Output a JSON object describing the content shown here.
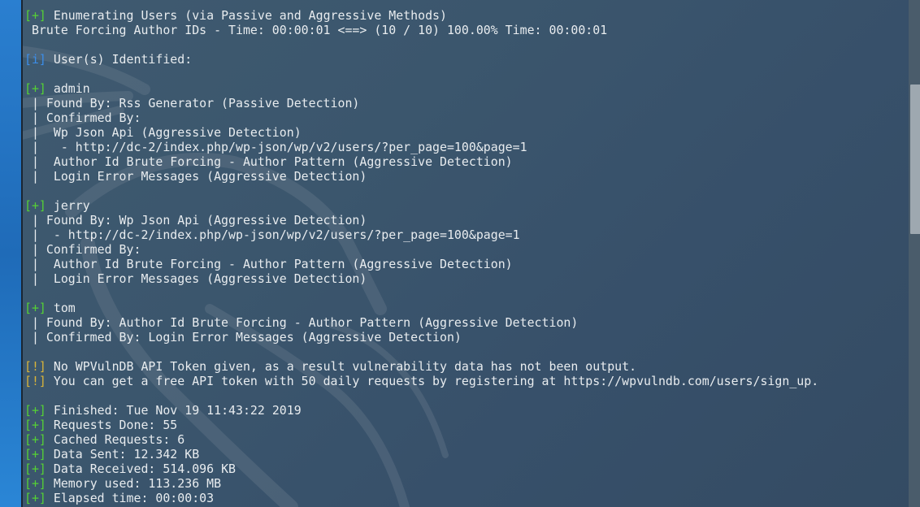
{
  "colors": {
    "plus_tag": "#55d135",
    "info_tag": "#3b8eea",
    "warn_tag": "#d9b43a",
    "text": "#e8ecef"
  },
  "lines": [
    {
      "tag": "[+]",
      "kind": "plus",
      "text": " Enumerating Users (via Passive and Aggressive Methods)"
    },
    {
      "tag": "",
      "kind": "",
      "text": " Brute Forcing Author IDs - Time: 00:00:01 <==> (10 / 10) 100.00% Time: 00:00:01"
    },
    {
      "tag": "",
      "kind": "",
      "text": ""
    },
    {
      "tag": "[i]",
      "kind": "info",
      "text": " User(s) Identified:"
    },
    {
      "tag": "",
      "kind": "",
      "text": ""
    },
    {
      "tag": "[+]",
      "kind": "plus",
      "text": " admin"
    },
    {
      "tag": "",
      "kind": "",
      "text": " | Found By: Rss Generator (Passive Detection)"
    },
    {
      "tag": "",
      "kind": "",
      "text": " | Confirmed By:"
    },
    {
      "tag": "",
      "kind": "",
      "text": " |  Wp Json Api (Aggressive Detection)"
    },
    {
      "tag": "",
      "kind": "",
      "text": " |   - http://dc-2/index.php/wp-json/wp/v2/users/?per_page=100&page=1"
    },
    {
      "tag": "",
      "kind": "",
      "text": " |  Author Id Brute Forcing - Author Pattern (Aggressive Detection)"
    },
    {
      "tag": "",
      "kind": "",
      "text": " |  Login Error Messages (Aggressive Detection)"
    },
    {
      "tag": "",
      "kind": "",
      "text": ""
    },
    {
      "tag": "[+]",
      "kind": "plus",
      "text": " jerry"
    },
    {
      "tag": "",
      "kind": "",
      "text": " | Found By: Wp Json Api (Aggressive Detection)"
    },
    {
      "tag": "",
      "kind": "",
      "text": " |  - http://dc-2/index.php/wp-json/wp/v2/users/?per_page=100&page=1"
    },
    {
      "tag": "",
      "kind": "",
      "text": " | Confirmed By:"
    },
    {
      "tag": "",
      "kind": "",
      "text": " |  Author Id Brute Forcing - Author Pattern (Aggressive Detection)"
    },
    {
      "tag": "",
      "kind": "",
      "text": " |  Login Error Messages (Aggressive Detection)"
    },
    {
      "tag": "",
      "kind": "",
      "text": ""
    },
    {
      "tag": "[+]",
      "kind": "plus",
      "text": " tom"
    },
    {
      "tag": "",
      "kind": "",
      "text": " | Found By: Author Id Brute Forcing - Author Pattern (Aggressive Detection)"
    },
    {
      "tag": "",
      "kind": "",
      "text": " | Confirmed By: Login Error Messages (Aggressive Detection)"
    },
    {
      "tag": "",
      "kind": "",
      "text": ""
    },
    {
      "tag": "[!]",
      "kind": "warn",
      "text": " No WPVulnDB API Token given, as a result vulnerability data has not been output."
    },
    {
      "tag": "[!]",
      "kind": "warn",
      "text": " You can get a free API token with 50 daily requests by registering at https://wpvulndb.com/users/sign_up."
    },
    {
      "tag": "",
      "kind": "",
      "text": ""
    },
    {
      "tag": "[+]",
      "kind": "plus",
      "text": " Finished: Tue Nov 19 11:43:22 2019"
    },
    {
      "tag": "[+]",
      "kind": "plus",
      "text": " Requests Done: 55"
    },
    {
      "tag": "[+]",
      "kind": "plus",
      "text": " Cached Requests: 6"
    },
    {
      "tag": "[+]",
      "kind": "plus",
      "text": " Data Sent: 12.342 KB"
    },
    {
      "tag": "[+]",
      "kind": "plus",
      "text": " Data Received: 514.096 KB"
    },
    {
      "tag": "[+]",
      "kind": "plus",
      "text": " Memory used: 113.236 MB"
    },
    {
      "tag": "[+]",
      "kind": "plus",
      "text": " Elapsed time: 00:00:03"
    }
  ]
}
